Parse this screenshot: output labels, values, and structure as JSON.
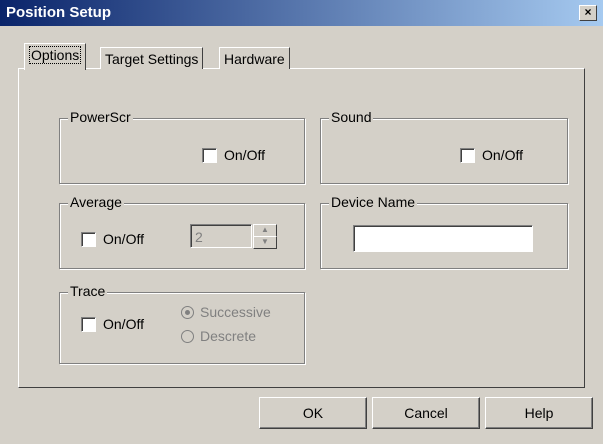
{
  "window": {
    "title": "Position Setup",
    "close_label": "×"
  },
  "tabs": [
    {
      "label": "Options"
    },
    {
      "label": "Target Settings"
    },
    {
      "label": "Hardware"
    }
  ],
  "powerscr": {
    "label": "PowerScr",
    "checkbox_label": "On/Off"
  },
  "sound": {
    "label": "Sound",
    "checkbox_label": "On/Off"
  },
  "average": {
    "label": "Average",
    "checkbox_label": "On/Off",
    "value": "2"
  },
  "device_name": {
    "label": "Device Name",
    "value": ""
  },
  "trace": {
    "label": "Trace",
    "checkbox_label": "On/Off",
    "radio_successive": "Successive",
    "radio_descrete": "Descrete"
  },
  "buttons": {
    "ok": "OK",
    "cancel": "Cancel",
    "help": "Help"
  }
}
